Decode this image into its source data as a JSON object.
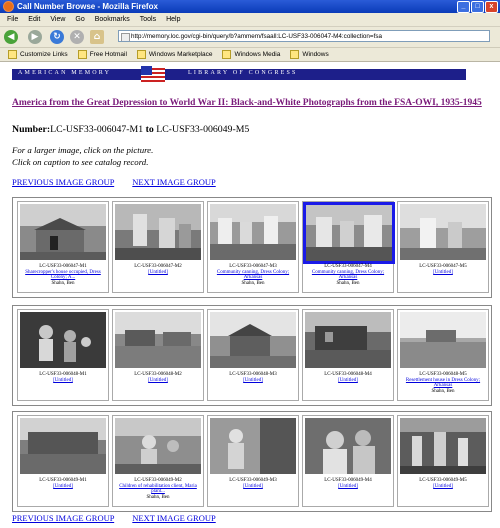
{
  "window": {
    "title": "Call Number Browse - Mozilla Firefox",
    "buttons": [
      "_",
      "□",
      "x"
    ]
  },
  "menu": [
    "File",
    "Edit",
    "View",
    "Go",
    "Bookmarks",
    "Tools",
    "Help"
  ],
  "address": {
    "url": "http://memory.loc.gov/cgi-bin/query/b?ammem/fsaall:LC-USF33-006047-M4:collection=fsa"
  },
  "bookmarks": [
    "Customize Links",
    "Free Hotmail",
    "Windows Marketplace",
    "Windows Media",
    "Windows"
  ],
  "banner": {
    "left": "AMERICAN MEMORY",
    "right": "LIBRARY OF CONGRESS"
  },
  "collection_title": "America from the Great Depression to World War II: Black-and-White Photographs from the FSA-OWI, 1935-1945",
  "number": {
    "label": "Number:",
    "from": "LC-USF33-006047-M1",
    "to_word": "to",
    "to": "LC-USF33-006049-M5"
  },
  "instructions": [
    "For a larger image, click on the picture.",
    "Click on caption to see catalog record."
  ],
  "nav": {
    "previous": "PREVIOUS IMAGE GROUP",
    "next": "NEXT IMAGE GROUP"
  },
  "groups": [
    {
      "items": [
        {
          "id": "LC-USF33-006047-M1",
          "caption": "Sharecropper's house occupied, Dress Colony; A...",
          "author": "Shahn, Ben"
        },
        {
          "id": "LC-USF33-006047-M2",
          "caption": "[Untitled]",
          "author": ""
        },
        {
          "id": "LC-USF33-006047-M3",
          "caption": "Community canning, Dress Colony; Arkansas",
          "author": "Shahn, Ben"
        },
        {
          "id": "LC-USF33-006047-M4",
          "caption": "Community canning, Dress Colony; Arkansas",
          "author": "Shahn, Ben"
        },
        {
          "id": "LC-USF33-006047-M5",
          "caption": "[Untitled]",
          "author": ""
        }
      ]
    },
    {
      "items": [
        {
          "id": "LC-USF33-006048-M1",
          "caption": "[Untitled]",
          "author": ""
        },
        {
          "id": "LC-USF33-006048-M2",
          "caption": "[Untitled]",
          "author": ""
        },
        {
          "id": "LC-USF33-006048-M3",
          "caption": "[Untitled]",
          "author": ""
        },
        {
          "id": "LC-USF33-006048-M4",
          "caption": "[Untitled]",
          "author": ""
        },
        {
          "id": "LC-USF33-006048-M5",
          "caption": "Resettlement house in Dress Colony; Arkansas",
          "author": "Shahn, Ben"
        }
      ]
    },
    {
      "items": [
        {
          "id": "LC-USF33-006049-M1",
          "caption": "[Untitled]",
          "author": ""
        },
        {
          "id": "LC-USF33-006049-M2",
          "caption": "Children of rehabilitation client, Maria plant...",
          "author": "Shahn, Ben"
        },
        {
          "id": "LC-USF33-006049-M3",
          "caption": "[Untitled]",
          "author": ""
        },
        {
          "id": "LC-USF33-006049-M4",
          "caption": "[Untitled]",
          "author": ""
        },
        {
          "id": "LC-USF33-006049-M5",
          "caption": "[Untitled]",
          "author": ""
        }
      ]
    }
  ],
  "colors": {
    "link": "#0000dd",
    "visited": "#7a1b7a",
    "banner": "#1d1f8a",
    "selected_border": "#1a1ae8"
  }
}
